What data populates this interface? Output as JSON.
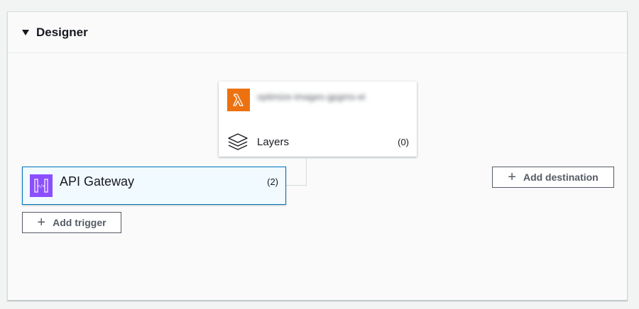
{
  "designer": {
    "title": "Designer"
  },
  "function": {
    "name": "optimize-images-gpgms-ei",
    "layers_label": "Layers",
    "layers_count": "(0)"
  },
  "trigger": {
    "label": "API Gateway",
    "count": "(2)"
  },
  "buttons": {
    "add_trigger": "Add trigger",
    "add_destination": "Add destination"
  },
  "colors": {
    "lambda": "#ec7211",
    "api_gateway": "#8c4fff",
    "selected_border": "#0073bb",
    "selected_fill": "#f1faff"
  },
  "icons": {
    "lambda": "lambda-icon",
    "layers": "layers-icon",
    "api_gateway": "api-gateway-icon",
    "plus": "plus-icon",
    "caret": "caret-down-icon"
  }
}
